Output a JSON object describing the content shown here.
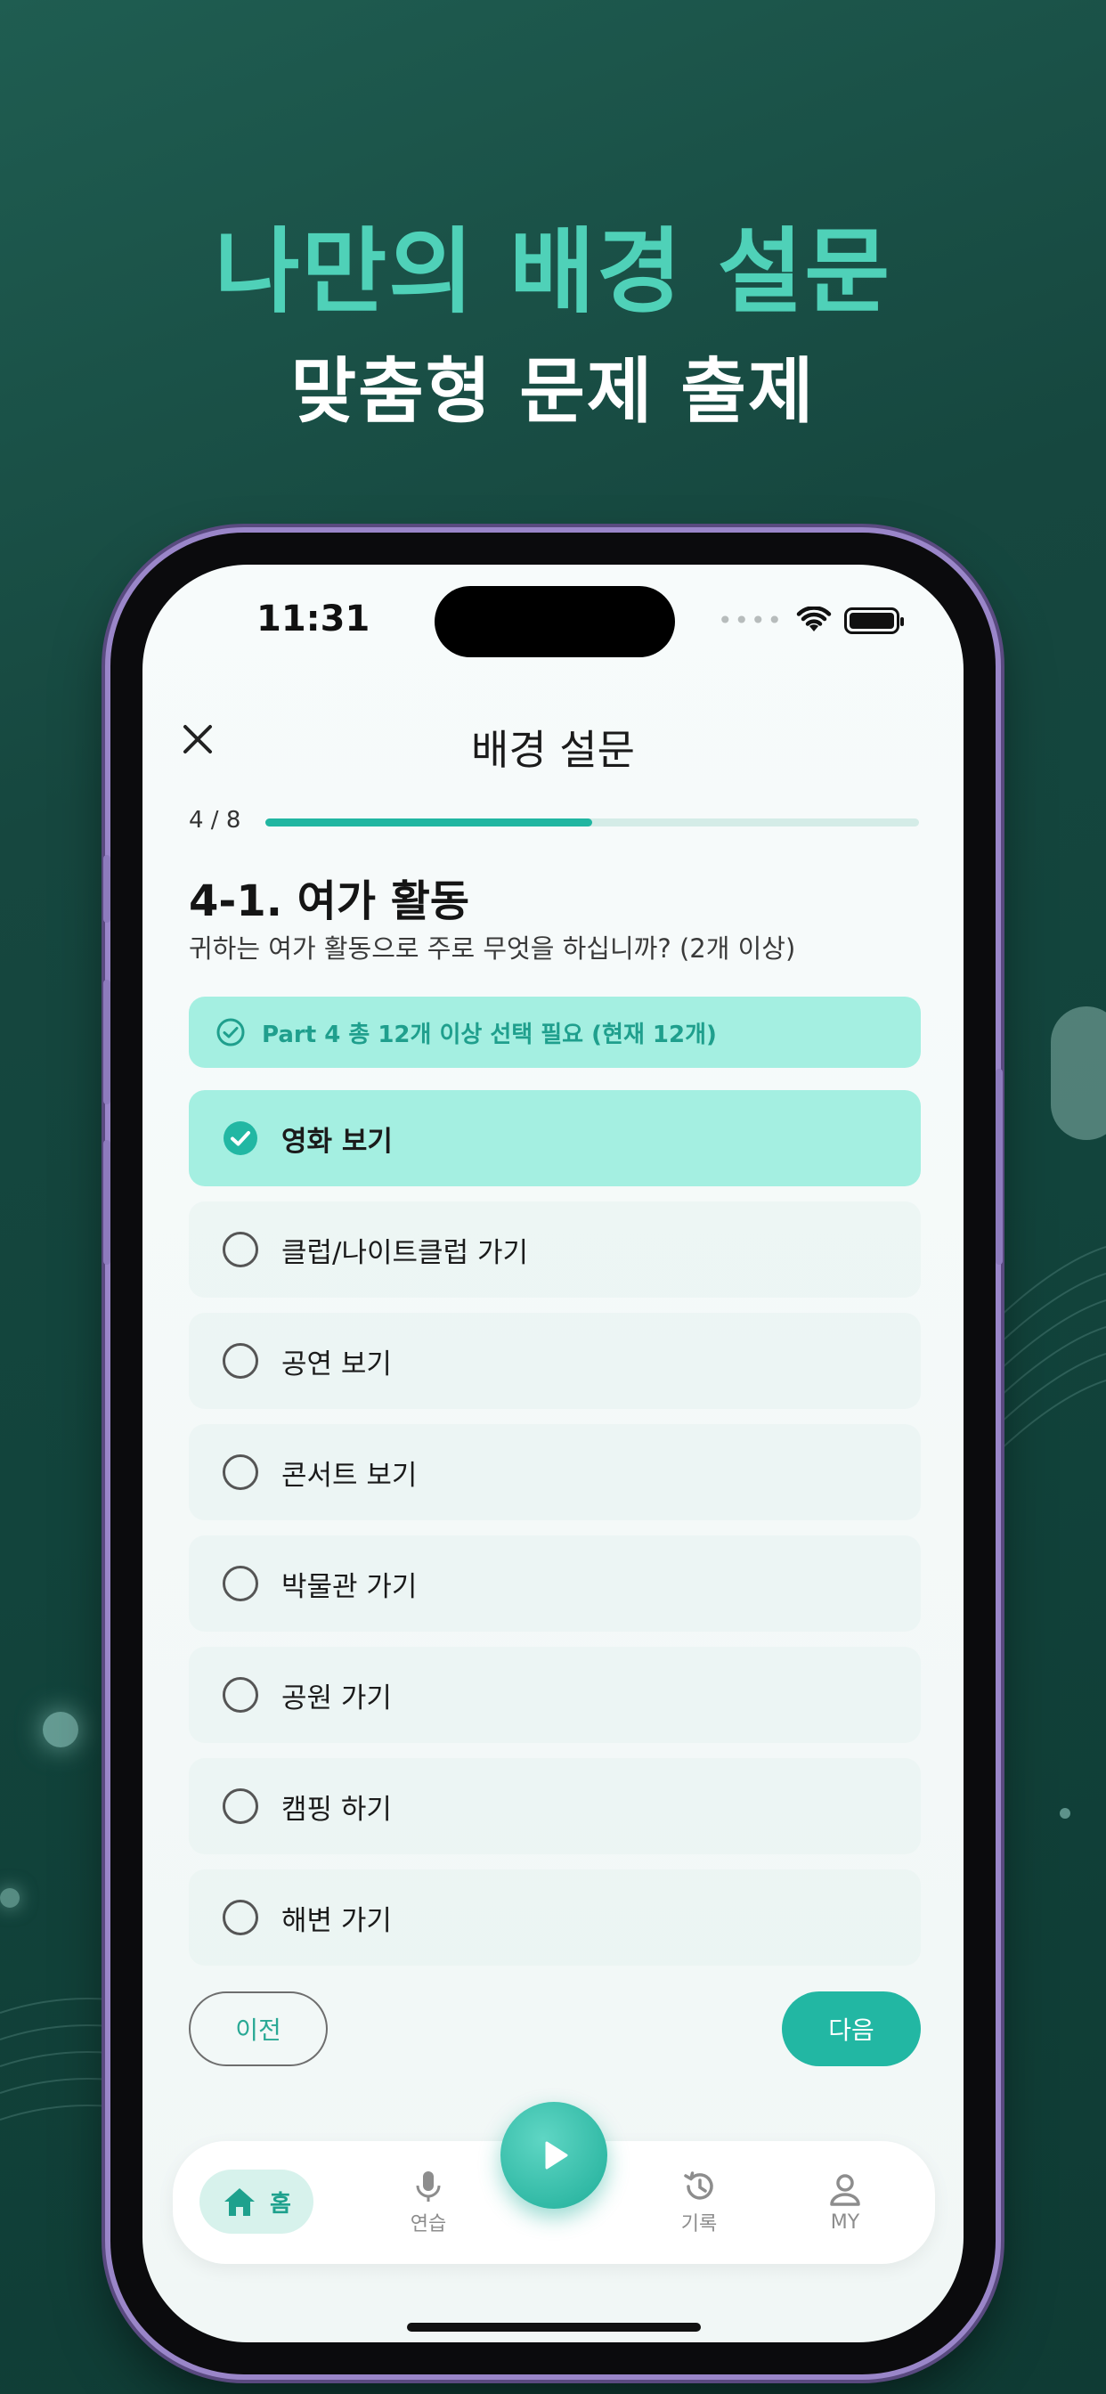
{
  "promo": {
    "headline": "나만의 배경 설문",
    "subline": "맞춤형 문제 출제"
  },
  "status_bar": {
    "time": "11:31",
    "dots": "••••"
  },
  "nav": {
    "title": "배경 설문"
  },
  "progress": {
    "label": "4 / 8",
    "fraction": 0.5
  },
  "question": {
    "title": "4-1. 여가 활동",
    "description": "귀하는 여가 활동으로 주로 무엇을 하십니까? (2개 이상)"
  },
  "notice": {
    "text": "Part 4 총 12개 이상 선택 필요 (현재 12개)"
  },
  "options": [
    {
      "label": "영화 보기",
      "selected": true
    },
    {
      "label": "클럽/나이트클럽 가기",
      "selected": false
    },
    {
      "label": "공연 보기",
      "selected": false
    },
    {
      "label": "콘서트 보기",
      "selected": false
    },
    {
      "label": "박물관 가기",
      "selected": false
    },
    {
      "label": "공원 가기",
      "selected": false
    },
    {
      "label": "캠핑 하기",
      "selected": false
    },
    {
      "label": "해변 가기",
      "selected": false
    }
  ],
  "buttons": {
    "prev": "이전",
    "next": "다음"
  },
  "tabs": {
    "home": "홈",
    "practice": "연습",
    "history": "기록",
    "my": "MY"
  },
  "colors": {
    "accent": "#21b6a1",
    "accent_light": "#a4efe1",
    "headline": "#4fd1b8"
  }
}
